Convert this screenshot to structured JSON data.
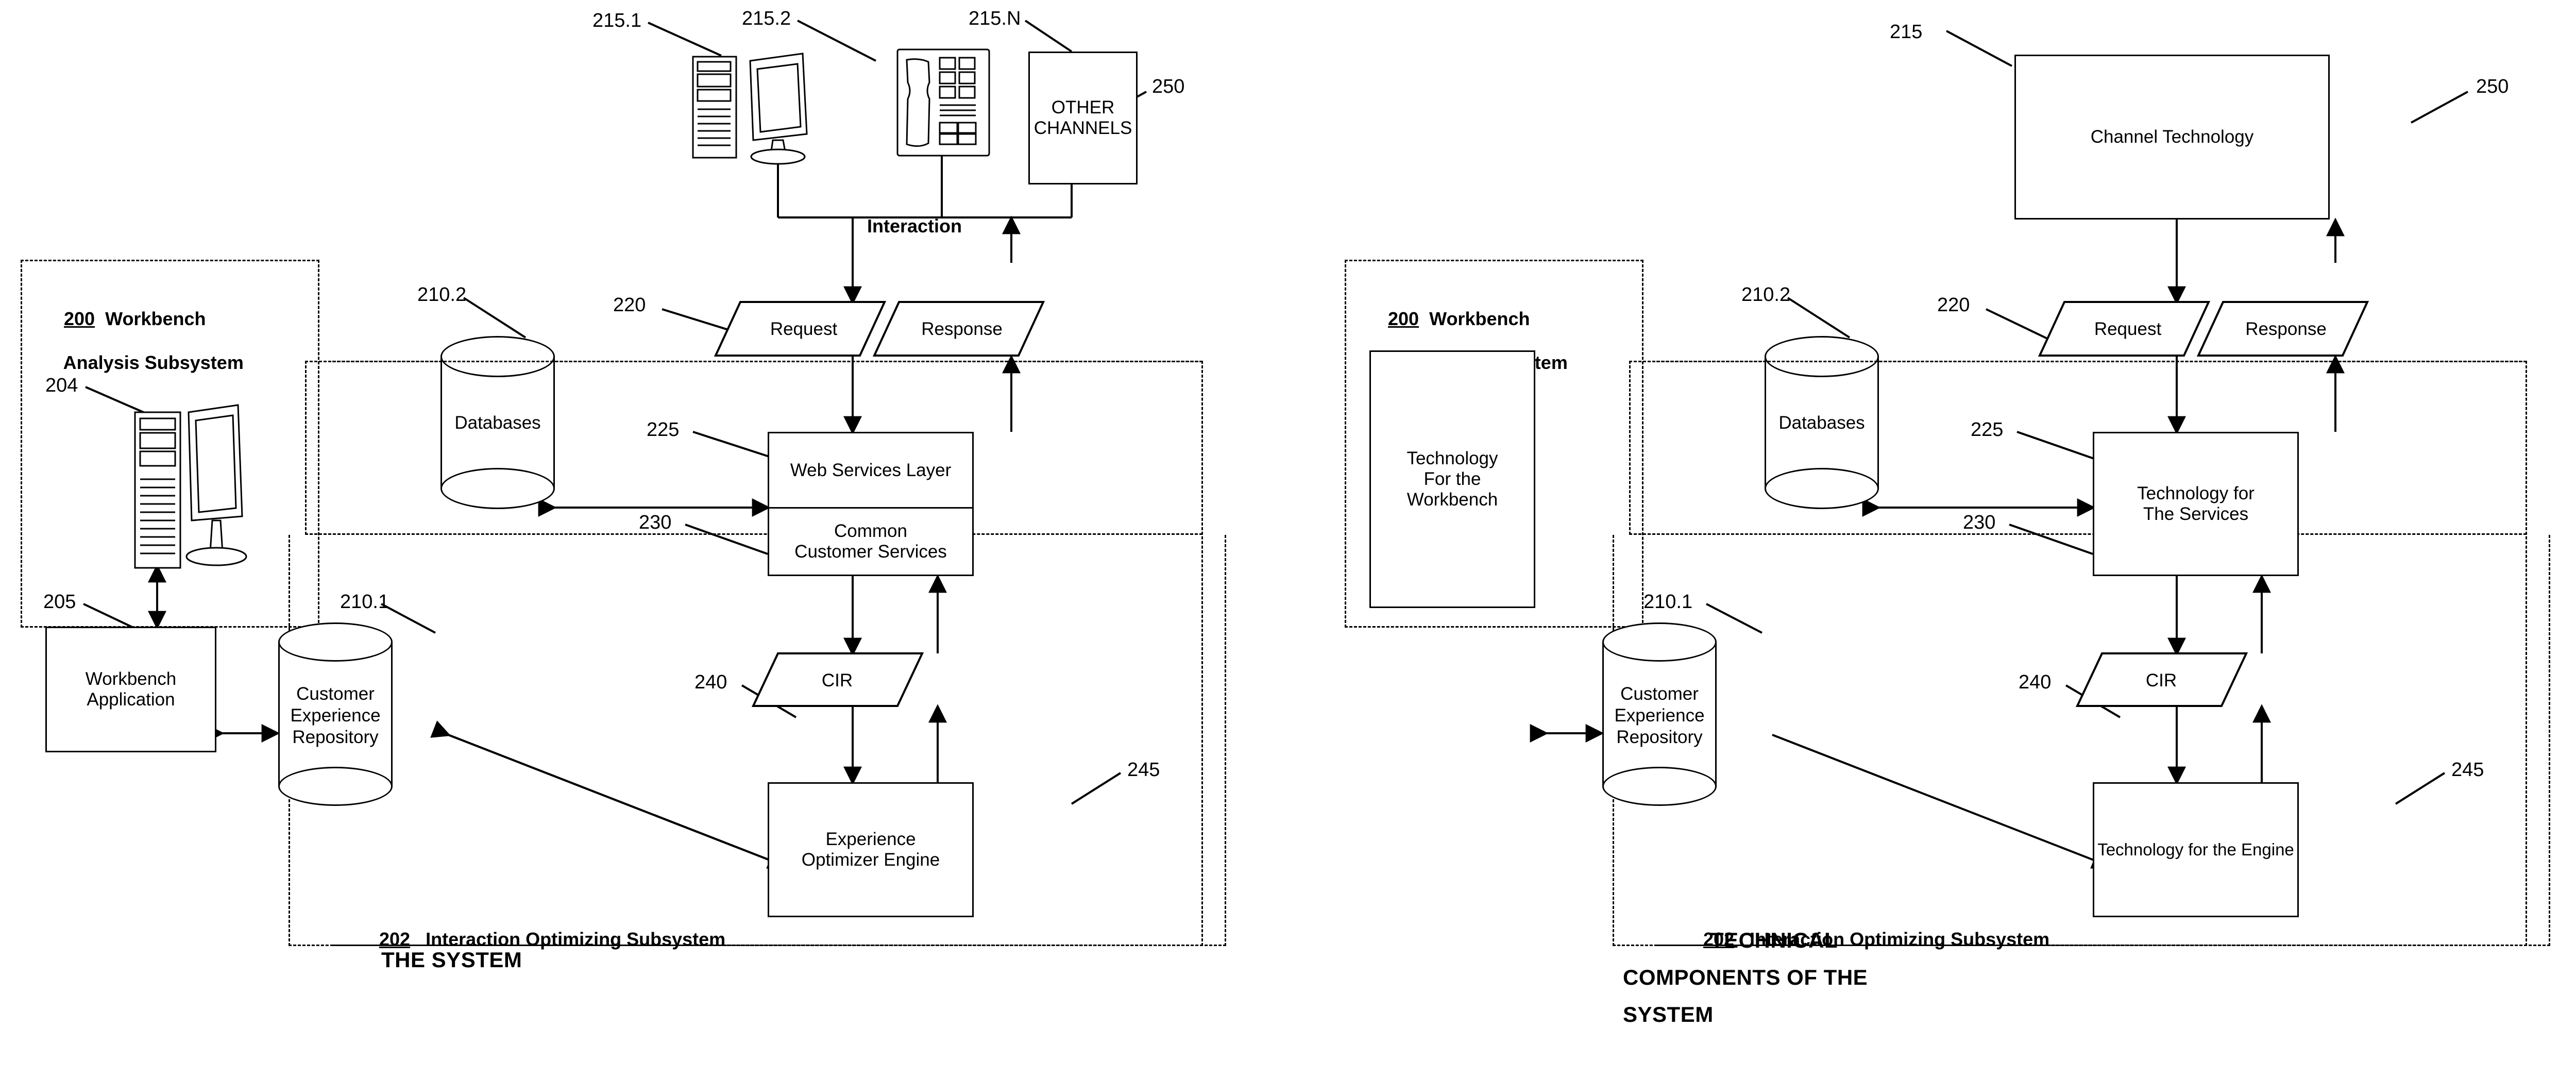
{
  "figure": {
    "left_panel": {
      "caption": "THE SYSTEM",
      "channels": {
        "ref_desktop": "215.1",
        "ref_phone": "215.2",
        "ref_other": "215.N",
        "other_channels_line1": "OTHER",
        "other_channels_line2": "CHANNELS",
        "interaction_label": "Interaction"
      },
      "workbench_subsystem": {
        "ref": "200",
        "title": "Workbench",
        "title_line2": "Analysis Subsystem",
        "computer_ref": "204",
        "app_ref": "205",
        "app_line1": "Workbench",
        "app_line2": "Application"
      },
      "databases": {
        "ref": "210.2",
        "label": "Databases"
      },
      "repository": {
        "ref": "210.1",
        "line1": "Customer",
        "line2": "Experience",
        "line3": "Repository"
      },
      "request": {
        "ref": "220",
        "label": "Request"
      },
      "response": {
        "ref": "250",
        "label": "Response"
      },
      "services": {
        "ref_top": "225",
        "ref_bottom": "230",
        "top_label": "Web Services Layer",
        "bottom_line1": "Common",
        "bottom_line2": "Customer Services"
      },
      "cir": {
        "ref": "240",
        "label": "CIR"
      },
      "engine": {
        "ref": "245",
        "line1": "Experience",
        "line2": "Optimizer Engine"
      },
      "interaction_subsystem": {
        "ref": "202",
        "title": "Interaction Optimizing Subsystem"
      }
    },
    "right_panel": {
      "caption_line1": "TECHNICAL",
      "caption_line2": "COMPONENTS OF THE",
      "caption_line3": "SYSTEM",
      "channel_technology": {
        "ref": "215",
        "label": "Channel Technology"
      },
      "workbench_subsystem": {
        "ref": "200",
        "title": "Workbench",
        "title_line2": "Analysis Subsystem",
        "tech_line1": "Technology",
        "tech_line2": "For the",
        "tech_line3": "Workbench"
      },
      "databases": {
        "ref": "210.2",
        "label": "Databases"
      },
      "repository": {
        "ref": "210.1",
        "line1": "Customer",
        "line2": "Experience",
        "line3": "Repository"
      },
      "request": {
        "ref": "220",
        "label": "Request"
      },
      "response": {
        "ref": "250",
        "label": "Response"
      },
      "services": {
        "ref_top": "225",
        "ref_bottom": "230",
        "line1": "Technology for",
        "line2": "The Services"
      },
      "cir": {
        "ref": "240",
        "label": "CIR"
      },
      "engine": {
        "ref": "245",
        "label": "Technology for the Engine"
      },
      "interaction_subsystem": {
        "ref": "202",
        "title": "Interaction Optimizing Subsystem"
      }
    }
  }
}
